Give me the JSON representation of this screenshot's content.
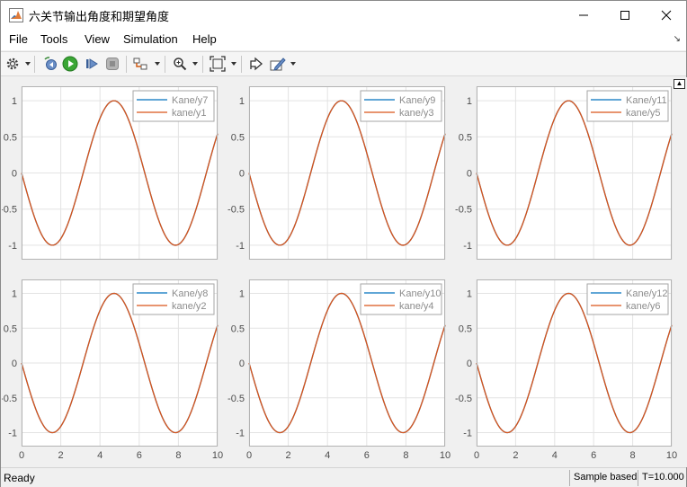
{
  "window": {
    "title": "六关节输出角度和期望角度"
  },
  "menu": [
    "File",
    "Tools",
    "View",
    "Simulation",
    "Help"
  ],
  "toolbar": {
    "icons": [
      "configuration-properties",
      "restore-step-back",
      "run",
      "step-forward",
      "stop",
      "signal-selector",
      "zoom",
      "zoom-to-fit",
      "highlight-to-model",
      "edit-legend"
    ]
  },
  "status": {
    "ready": "Ready",
    "sample_mode": "Sample based",
    "time": "T=10.000"
  },
  "colors": {
    "series_blue": "#0072bd",
    "series_orange": "#d95319",
    "grid": "#e3e3e3",
    "axes": "#262626"
  },
  "chart_data": [
    {
      "type": "line",
      "xlim": [
        0,
        10
      ],
      "ylim": [
        -1.2,
        1.2
      ],
      "xticks": [
        0,
        2,
        4,
        6,
        8,
        10
      ],
      "yticks": [
        1,
        0.5,
        0,
        -0.5,
        -1
      ],
      "grid": true,
      "legend_position": "top-right",
      "series": [
        {
          "name": "Kane/y7",
          "function": "-sin(t)"
        },
        {
          "name": "kane/y1",
          "function": "-sin(t)"
        }
      ]
    },
    {
      "type": "line",
      "xlim": [
        0,
        10
      ],
      "ylim": [
        -1.2,
        1.2
      ],
      "xticks": [
        0,
        2,
        4,
        6,
        8,
        10
      ],
      "yticks": [
        1,
        0.5,
        0,
        -0.5,
        -1
      ],
      "grid": true,
      "legend_position": "top-right",
      "series": [
        {
          "name": "Kane/y9",
          "function": "-sin(t)"
        },
        {
          "name": "kane/y3",
          "function": "-sin(t)"
        }
      ]
    },
    {
      "type": "line",
      "xlim": [
        0,
        10
      ],
      "ylim": [
        -1.2,
        1.2
      ],
      "xticks": [
        0,
        2,
        4,
        6,
        8,
        10
      ],
      "yticks": [
        1,
        0.5,
        0,
        -0.5,
        -1
      ],
      "grid": true,
      "legend_position": "top-right",
      "series": [
        {
          "name": "Kane/y11",
          "function": "-sin(t)"
        },
        {
          "name": "kane/y5",
          "function": "-sin(t)"
        }
      ]
    },
    {
      "type": "line",
      "xlim": [
        0,
        10
      ],
      "ylim": [
        -1.2,
        1.2
      ],
      "xticks": [
        0,
        2,
        4,
        6,
        8,
        10
      ],
      "yticks": [
        1,
        0.5,
        0,
        -0.5,
        -1
      ],
      "grid": true,
      "legend_position": "top-right",
      "series": [
        {
          "name": "Kane/y8",
          "function": "-sin(t)"
        },
        {
          "name": "kane/y2",
          "function": "-sin(t)"
        }
      ]
    },
    {
      "type": "line",
      "xlim": [
        0,
        10
      ],
      "ylim": [
        -1.2,
        1.2
      ],
      "xticks": [
        0,
        2,
        4,
        6,
        8,
        10
      ],
      "yticks": [
        1,
        0.5,
        0,
        -0.5,
        -1
      ],
      "grid": true,
      "legend_position": "top-right",
      "series": [
        {
          "name": "Kane/y10",
          "function": "-sin(t)"
        },
        {
          "name": "kane/y4",
          "function": "-sin(t)"
        }
      ]
    },
    {
      "type": "line",
      "xlim": [
        0,
        10
      ],
      "ylim": [
        -1.2,
        1.2
      ],
      "xticks": [
        0,
        2,
        4,
        6,
        8,
        10
      ],
      "yticks": [
        1,
        0.5,
        0,
        -0.5,
        -1
      ],
      "grid": true,
      "legend_position": "top-right",
      "series": [
        {
          "name": "Kane/y12",
          "function": "-sin(t)"
        },
        {
          "name": "kane/y6",
          "function": "-sin(t)"
        }
      ]
    }
  ]
}
